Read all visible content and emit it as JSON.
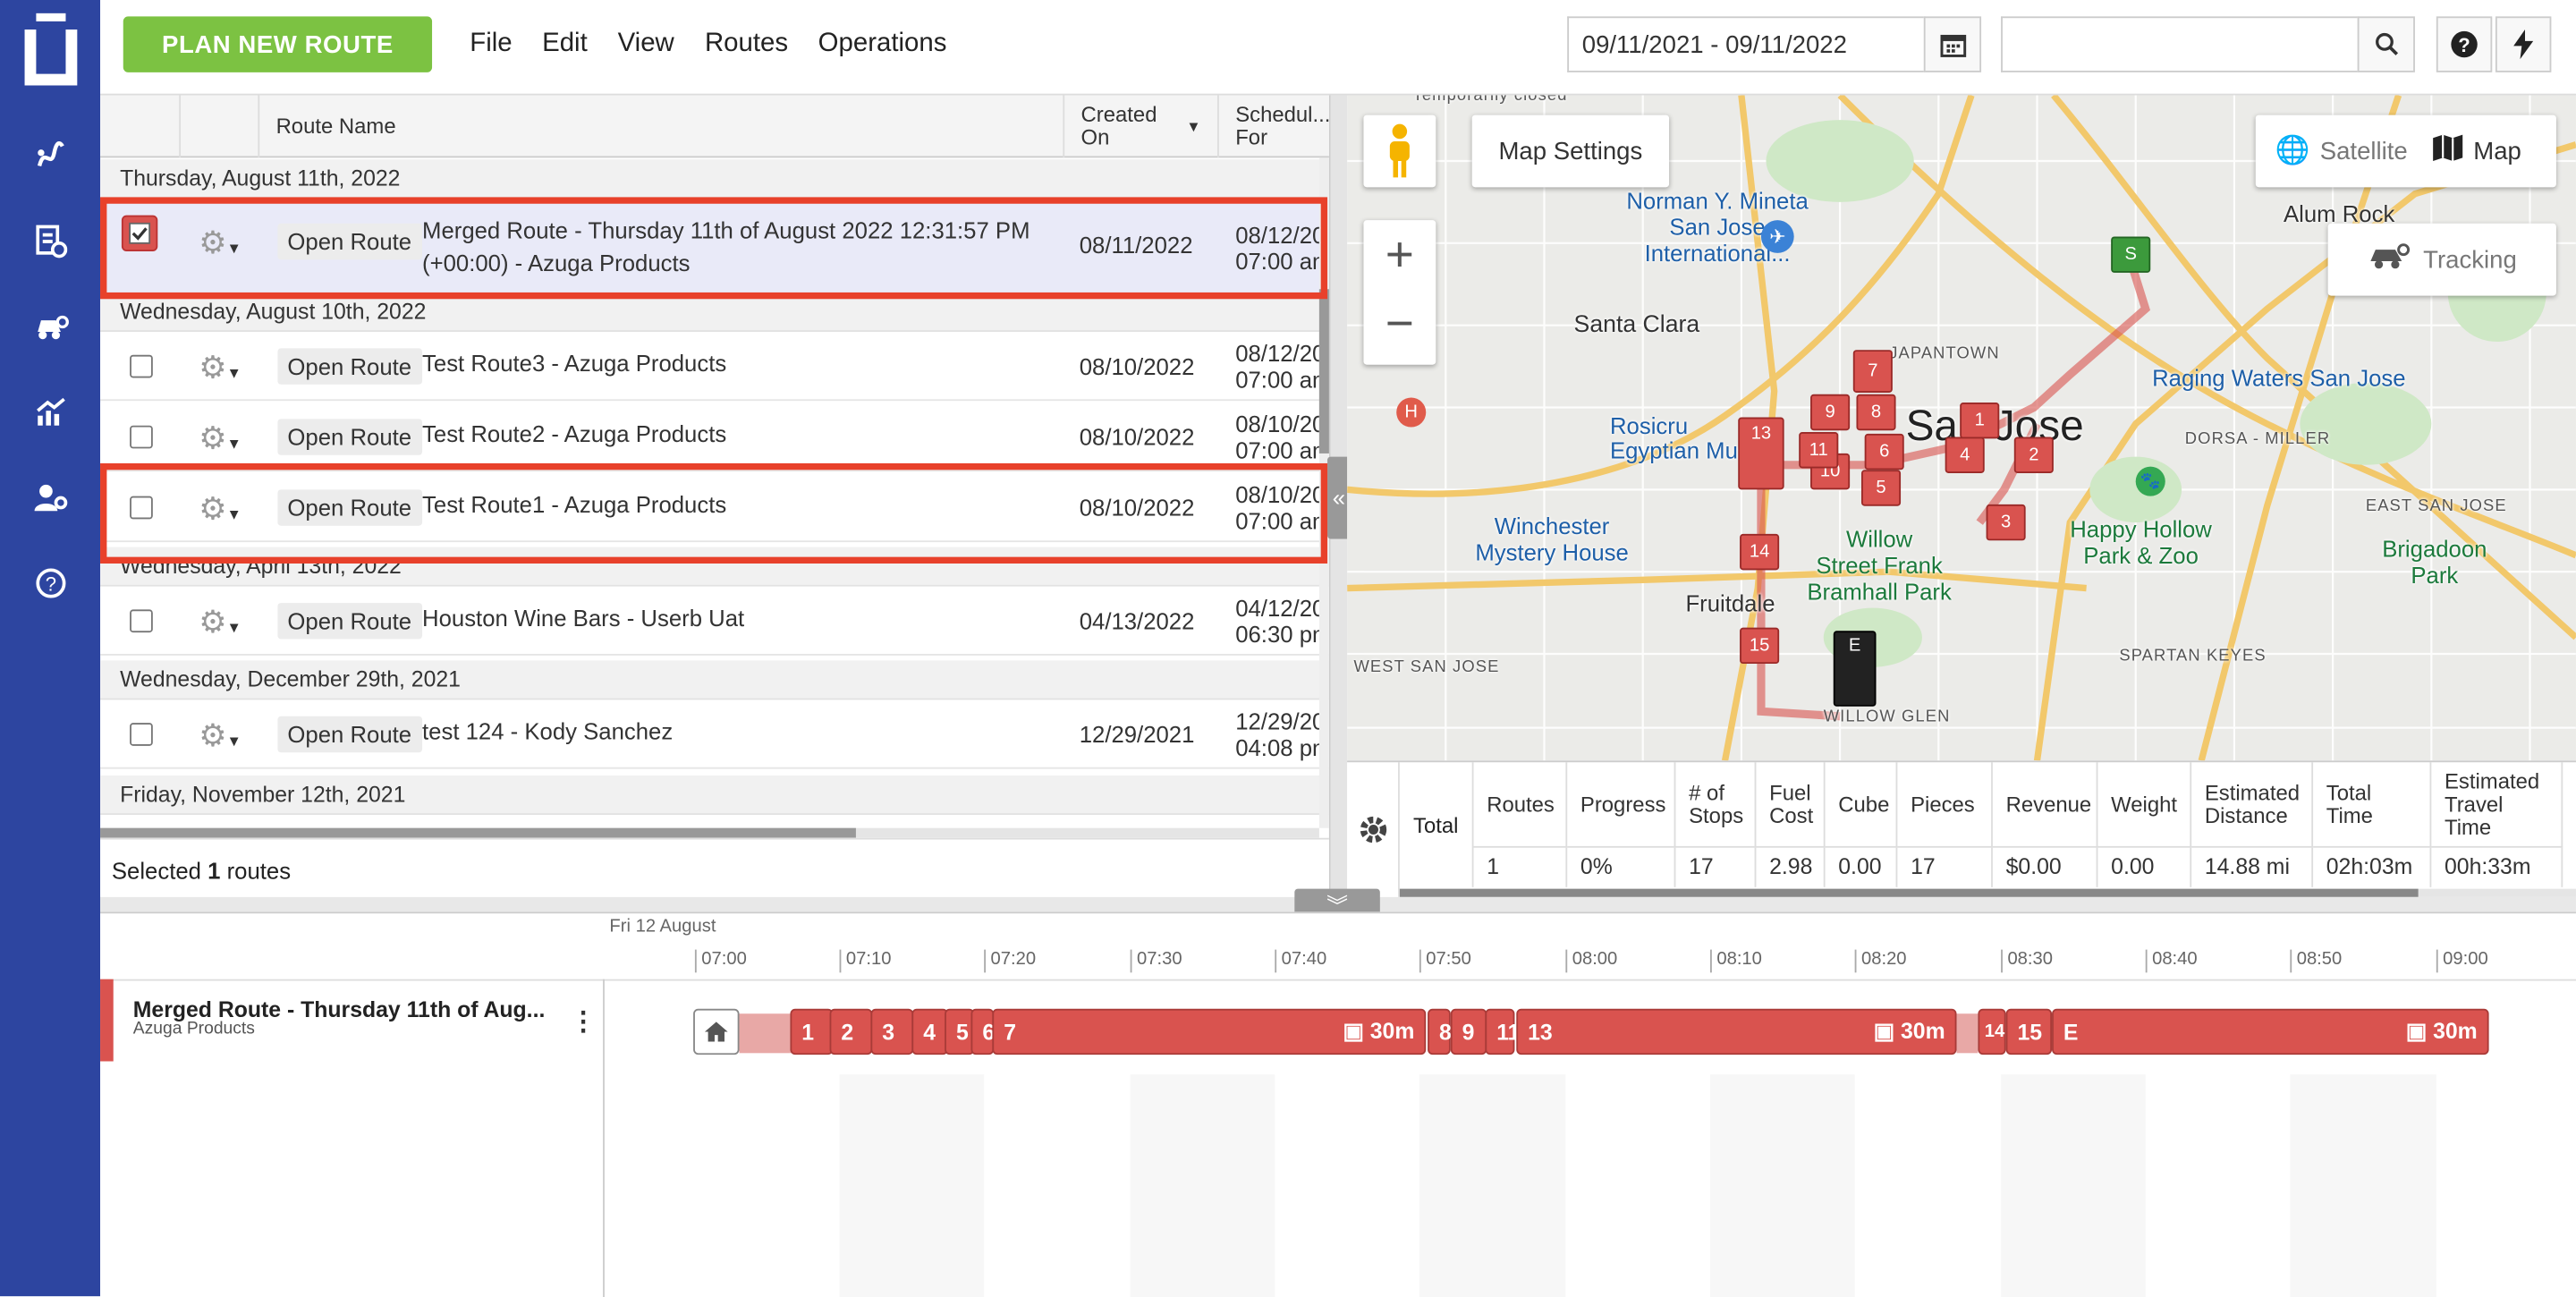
{
  "toolbar": {
    "plan_label": "PLAN NEW ROUTE",
    "menus": [
      "File",
      "Edit",
      "View",
      "Routes",
      "Operations"
    ],
    "date_range": "09/11/2021 - 09/11/2022",
    "search_value": ""
  },
  "grid": {
    "headers": {
      "route_name": "Route Name",
      "created_on": "Created On",
      "scheduled_for": "Schedul... For"
    },
    "groups": [
      "Thursday, August 11th, 2022",
      "Wednesday, August 10th, 2022",
      "Wednesday, April 13th, 2022",
      "Wednesday, December 29th, 2021",
      "Friday, November 12th, 2021"
    ],
    "open_label": "Open Route",
    "rows": [
      {
        "name": "Merged Route - Thursday 11th of August 2022 12:31:57 PM (+00:00) - Azuga Products",
        "created": "08/11/2022",
        "sched1": "08/12/20",
        "sched2": "07:00 am",
        "checked": true
      },
      {
        "name": "Test Route3 - Azuga Products",
        "created": "08/10/2022",
        "sched1": "08/12/20",
        "sched2": "07:00 am",
        "checked": false
      },
      {
        "name": "Test Route2 - Azuga Products",
        "created": "08/10/2022",
        "sched1": "08/10/20",
        "sched2": "07:00 am",
        "checked": false
      },
      {
        "name": "Test Route1 - Azuga Products",
        "created": "08/10/2022",
        "sched1": "08/10/20",
        "sched2": "07:00 am",
        "checked": false
      },
      {
        "name": "Houston Wine Bars - Userb Uat",
        "created": "04/13/2022",
        "sched1": "04/12/20",
        "sched2": "06:30 pm",
        "checked": false
      },
      {
        "name": "test 124 - Kody Sanchez",
        "created": "12/29/2021",
        "sched1": "12/29/20",
        "sched2": "04:08 pm",
        "checked": false
      }
    ],
    "footer_prefix": "Selected",
    "footer_count": "1",
    "footer_suffix": "routes"
  },
  "map": {
    "settings_label": "Map Settings",
    "satellite_label": "Satellite",
    "map_label": "Map",
    "tracking_label": "Tracking",
    "places": [
      "Norman Y. Mineta",
      "San Jose",
      "International...",
      "Santa Clara",
      "JAPANTOWN",
      "San Jose",
      "Raging Waters San Jose",
      "Alum Rock",
      "Rosicru",
      "Egyptian Mus",
      "Winchester",
      "Mystery House",
      "Willow",
      "Street Frank",
      "Bramhall Park",
      "Happy Hollow",
      "Park & Zoo",
      "Brigadoon",
      "Park",
      "Fruitdale",
      "WEST SAN JOSE",
      "SPARTAN KEYES",
      "EAST SAN JOSE",
      "DORSA - MILLER",
      "WILLOW GLEN",
      "Temporarily closed"
    ],
    "stops": [
      "S",
      "1",
      "2",
      "3",
      "4",
      "5",
      "6",
      "7",
      "8",
      "9",
      "10",
      "11",
      "13",
      "14",
      "15",
      "E"
    ]
  },
  "summary": {
    "label": "Total",
    "headers": [
      "Routes",
      "Progress",
      "# of Stops",
      "Fuel Cost",
      "Cube",
      "Pieces",
      "Revenue",
      "Weight",
      "Estimated Distance",
      "Total Time",
      "Estimated Travel Time"
    ],
    "values": [
      "1",
      "0%",
      "17",
      "2.98",
      "0.00",
      "17",
      "$0.00",
      "0.00",
      "14.88 mi",
      "02h:03m",
      "00h:33m"
    ]
  },
  "timeline": {
    "date": "Fri 12 August",
    "ticks": [
      "07:00",
      "07:10",
      "07:20",
      "07:30",
      "07:40",
      "07:50",
      "08:00",
      "08:10",
      "08:20",
      "08:30",
      "08:40",
      "08:50",
      "09:00"
    ],
    "route_title": "Merged Route - Thursday 11th of Aug...",
    "route_sub": "Azuga Products",
    "segments": [
      "1",
      "2",
      "3",
      "4",
      "5",
      "6",
      "7",
      "8",
      "9",
      "11",
      "13",
      "14",
      "15",
      "E"
    ],
    "dwell": "30m"
  },
  "colors": {
    "accent": "#2d45a0",
    "plan": "#7cc242",
    "stop": "#d9534f",
    "highlight": "#e8412b"
  }
}
